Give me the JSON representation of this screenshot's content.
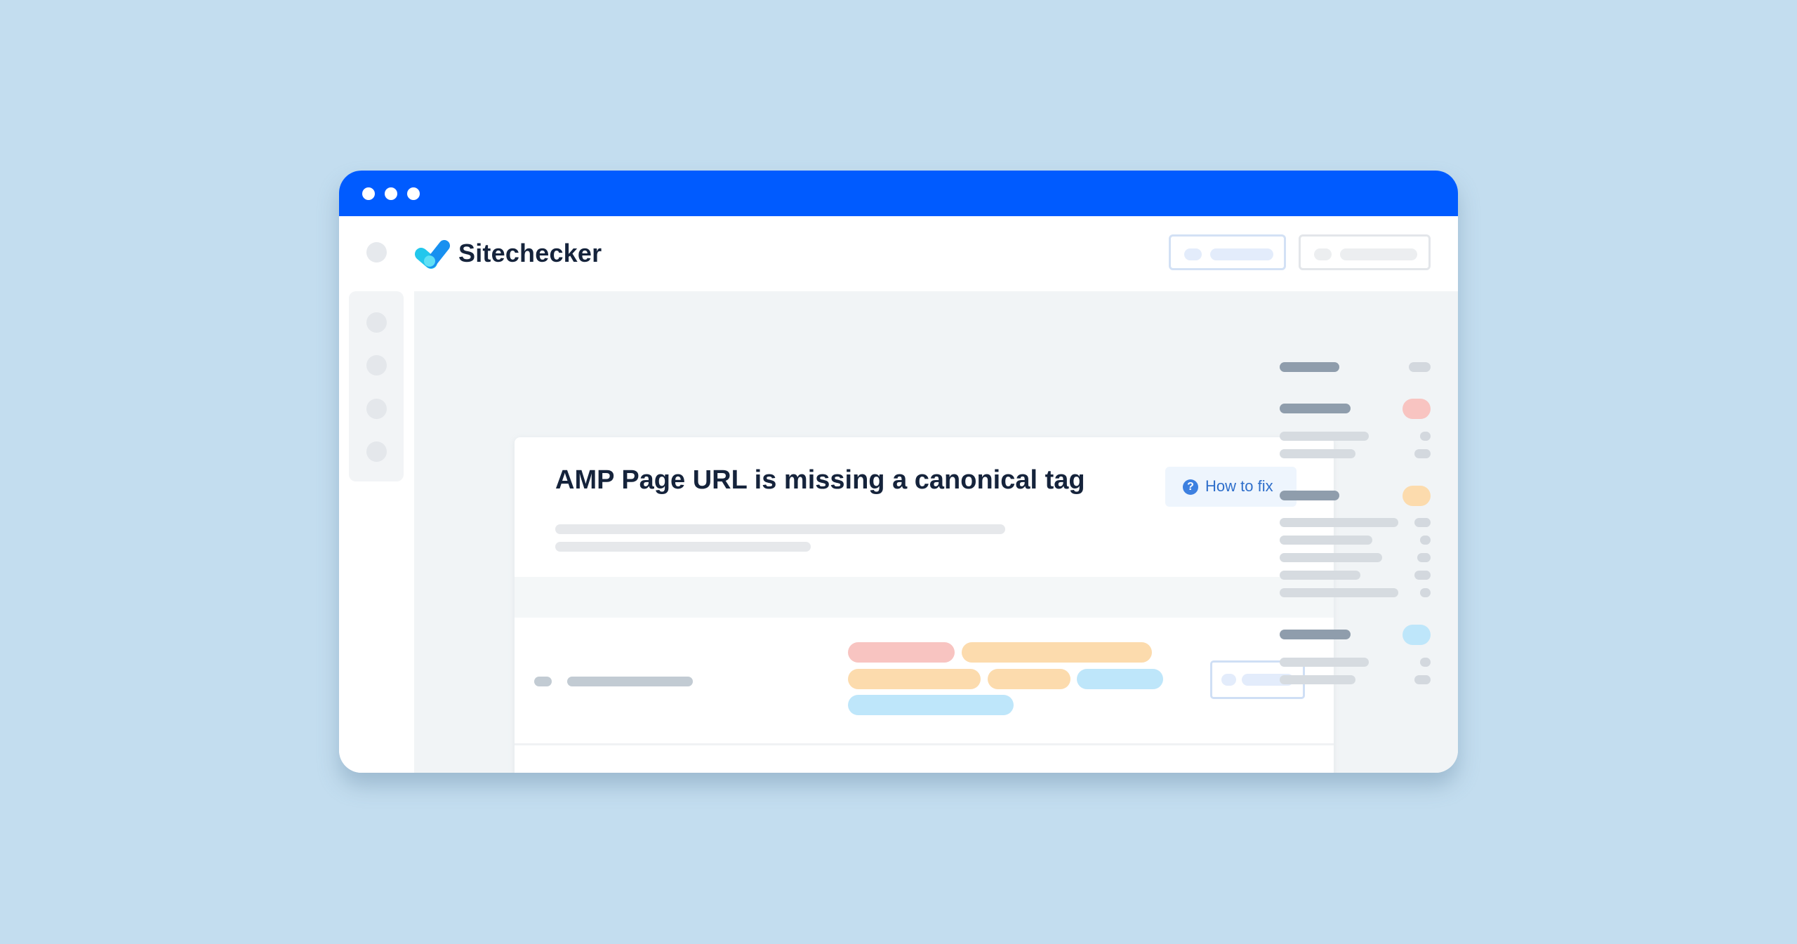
{
  "window": {
    "titlebar_color": "#005bff",
    "titlebar_dots": [
      "window-dot",
      "window-dot",
      "window-dot"
    ]
  },
  "header": {
    "brand_name": "Sitechecker",
    "logo_icon": "checkmark-logo-icon",
    "buttons": [
      {
        "name": "header-button-primary",
        "style": "blue-outline"
      },
      {
        "name": "header-button-secondary",
        "style": "gray-outline"
      }
    ]
  },
  "sidebar": {
    "items": [
      "sidebar-item-1",
      "sidebar-item-2",
      "sidebar-item-3",
      "sidebar-item-4"
    ]
  },
  "issue": {
    "title": "AMP Page URL is missing a canonical tag",
    "how_to_fix_label": "How to fix",
    "how_to_fix_icon": "?"
  },
  "rows": [
    {
      "tags": [
        [
          {
            "color": "red"
          },
          {
            "color": "orange"
          }
        ],
        [
          {
            "color": "orange"
          },
          {
            "color": "orange"
          },
          {
            "color": "blue"
          }
        ],
        [
          {
            "color": "blue"
          }
        ]
      ]
    },
    {
      "tags": [
        [
          {
            "color": "red"
          },
          {
            "color": "red"
          }
        ],
        [
          {
            "color": "orange"
          },
          {
            "color": "orange"
          }
        ]
      ]
    }
  ],
  "right_panel": {
    "groups": [
      {
        "badge": "gray",
        "lines": 0
      },
      {
        "badge": "red",
        "lines": 2
      },
      {
        "badge": "orange",
        "lines": 5
      },
      {
        "badge": "blue",
        "lines": 2
      }
    ]
  },
  "colors": {
    "background": "#c3ddef",
    "brand_blue": "#005bff",
    "title_text": "#15233b",
    "link_blue": "#2f6fcb",
    "tag_red": "#f8c4c1",
    "tag_orange": "#fcdbad",
    "tag_blue": "#bee6fa"
  }
}
